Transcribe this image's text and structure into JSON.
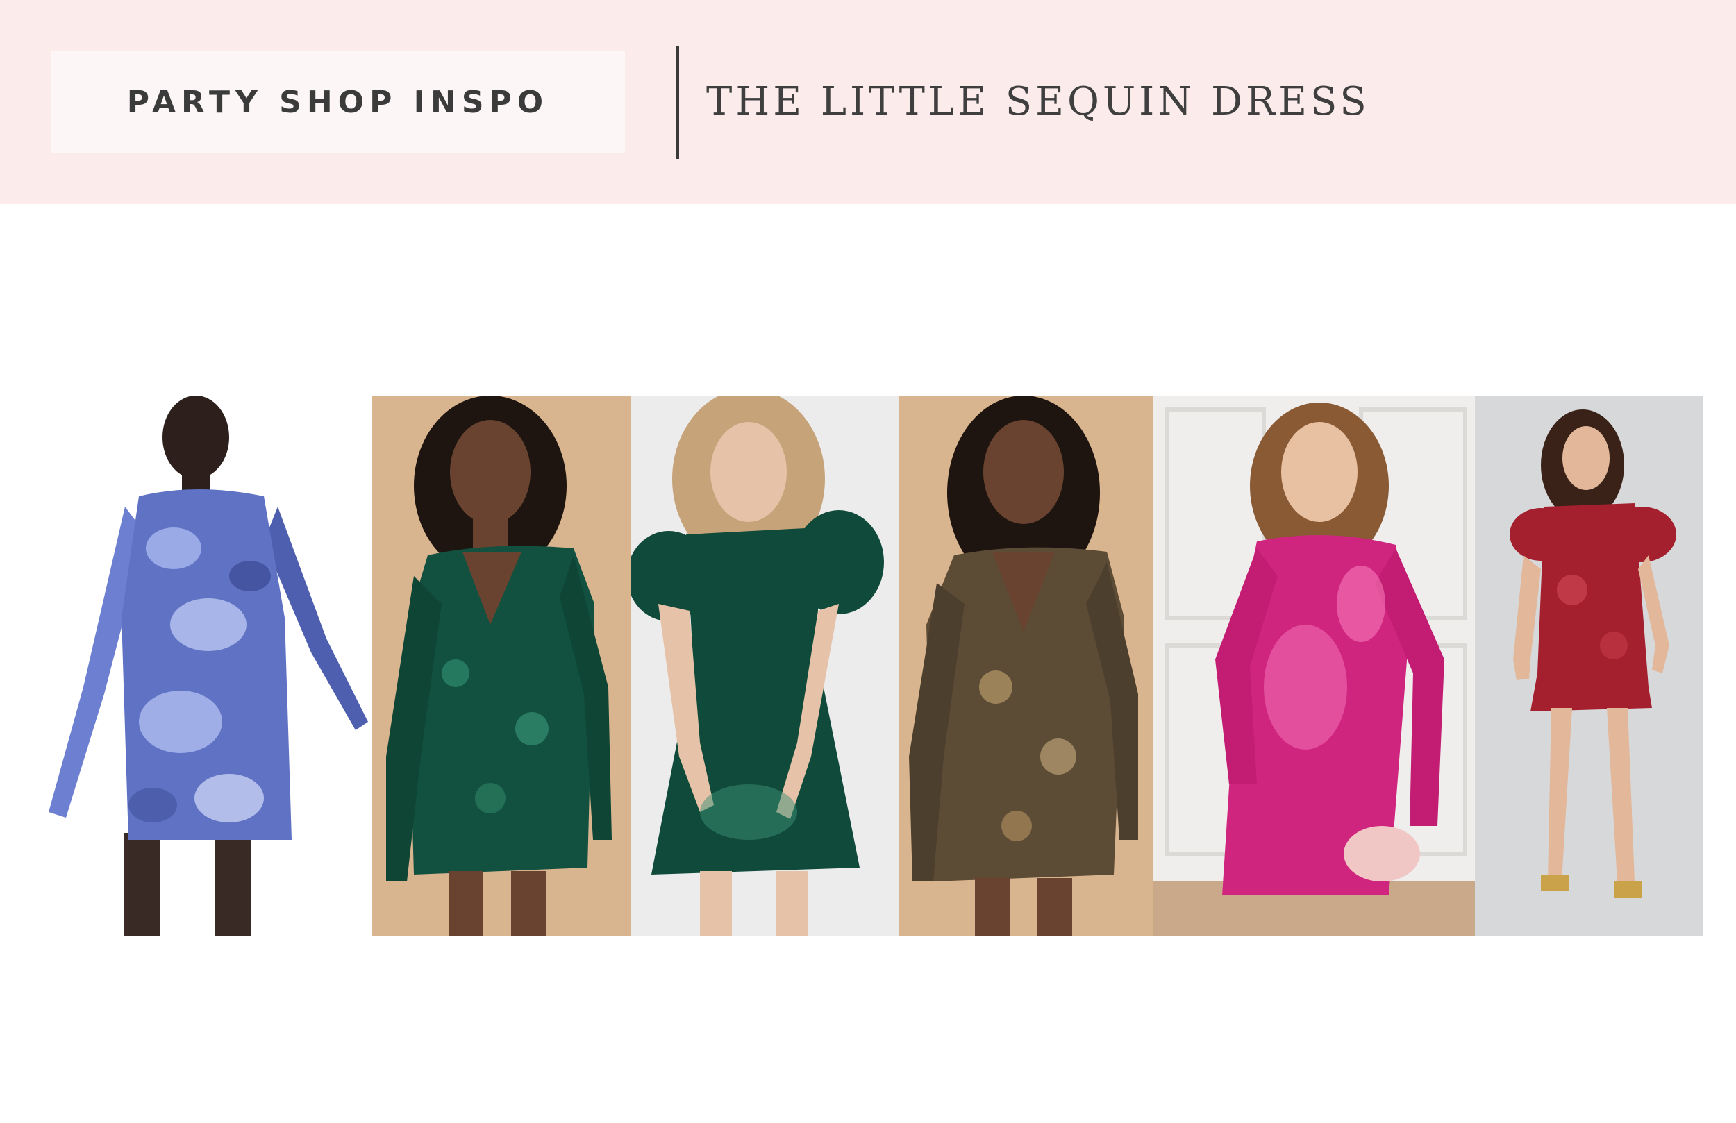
{
  "header": {
    "section_label": "PARTY SHOP INSPO",
    "page_title": "THE LITTLE SEQUIN DRESS",
    "background_color": "#fcebeb"
  },
  "gallery": {
    "photos": [
      {
        "name": "blue-sequin-dress-photo",
        "dress_color": "#5f72c4",
        "backdrop_color": "#ffffff"
      },
      {
        "name": "emerald-vneck-sequin-dress-photo",
        "dress_color": "#12503f",
        "backdrop_color": "#d9b58f"
      },
      {
        "name": "green-puff-sleeve-sequin-dress-photo",
        "dress_color": "#0f4a3a",
        "backdrop_color": "#ececec"
      },
      {
        "name": "gold-vneck-sequin-dress-photo",
        "dress_color": "#5c4b35",
        "backdrop_color": "#d9b58f"
      },
      {
        "name": "pink-sequin-dress-photo",
        "dress_color": "#d0257f",
        "backdrop_color": "#efeeec"
      },
      {
        "name": "red-sequin-dress-photo",
        "dress_color": "#a4202f",
        "backdrop_color": "#d7d8da"
      }
    ]
  }
}
